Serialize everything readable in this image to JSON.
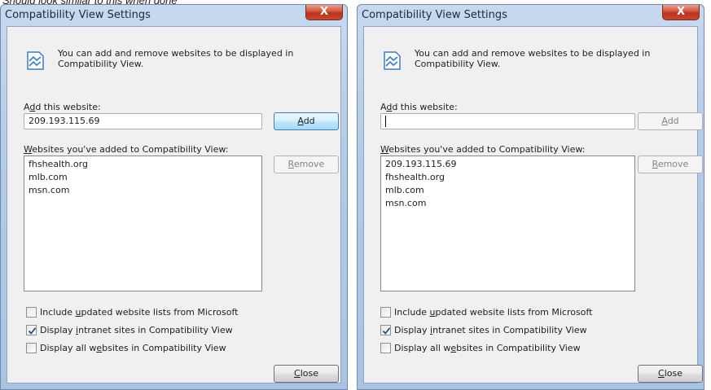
{
  "caption": "Should look similar to this when done",
  "dialogs": [
    {
      "title": "Compatibility View Settings",
      "close_glyph": "X",
      "info_text": "You can add and remove websites to be displayed in Compatibility View.",
      "info_icon": "compatibility-view-icon",
      "add_label": {
        "pre": "A",
        "u": "d",
        "post": "d this website:"
      },
      "add_input_value": "209.193.115.69",
      "add_button": {
        "pre": "",
        "u": "A",
        "post": "dd"
      },
      "add_button_state": "focused",
      "list_label": {
        "pre": "",
        "u": "W",
        "post": "ebsites you've added to Compatibility View:"
      },
      "sites": [
        "fhshealth.org",
        "mlb.com",
        "msn.com"
      ],
      "remove_button": {
        "pre": "",
        "u": "R",
        "post": "emove"
      },
      "remove_button_state": "disabled",
      "checks": [
        {
          "pre": "Include ",
          "u": "u",
          "post": "pdated website lists from Microsoft",
          "checked": false
        },
        {
          "pre": "Display ",
          "u": "i",
          "post": "ntranet sites in Compatibility View",
          "checked": true
        },
        {
          "pre": "Display all w",
          "u": "e",
          "post": "bsites in Compatibility View",
          "checked": false
        }
      ],
      "close_button": {
        "pre": "",
        "u": "C",
        "post": "lose"
      }
    },
    {
      "title": "Compatibility View Settings",
      "close_glyph": "X",
      "info_text": "You can add and remove websites to be displayed in Compatibility View.",
      "info_icon": "compatibility-view-icon",
      "add_label": {
        "pre": "A",
        "u": "d",
        "post": "d this website:"
      },
      "add_input_value": "",
      "add_button": {
        "pre": "",
        "u": "A",
        "post": "dd"
      },
      "add_button_state": "disabled",
      "list_label": {
        "pre": "",
        "u": "W",
        "post": "ebsites you've added to Compatibility View:"
      },
      "sites": [
        "209.193.115.69",
        "fhshealth.org",
        "mlb.com",
        "msn.com"
      ],
      "remove_button": {
        "pre": "",
        "u": "R",
        "post": "emove"
      },
      "remove_button_state": "disabled",
      "checks": [
        {
          "pre": "Include ",
          "u": "u",
          "post": "pdated website lists from Microsoft",
          "checked": false
        },
        {
          "pre": "Display ",
          "u": "i",
          "post": "ntranet sites in Compatibility View",
          "checked": true
        },
        {
          "pre": "Display all w",
          "u": "e",
          "post": "bsites in Compatibility View",
          "checked": false
        }
      ],
      "close_button": {
        "pre": "",
        "u": "C",
        "post": "lose"
      }
    }
  ],
  "colors": {
    "title_bar": "#b3cbe7",
    "close_button": "#c8472f",
    "focus_button": "#bee6fd",
    "client_bg": "#f0f0f0"
  }
}
